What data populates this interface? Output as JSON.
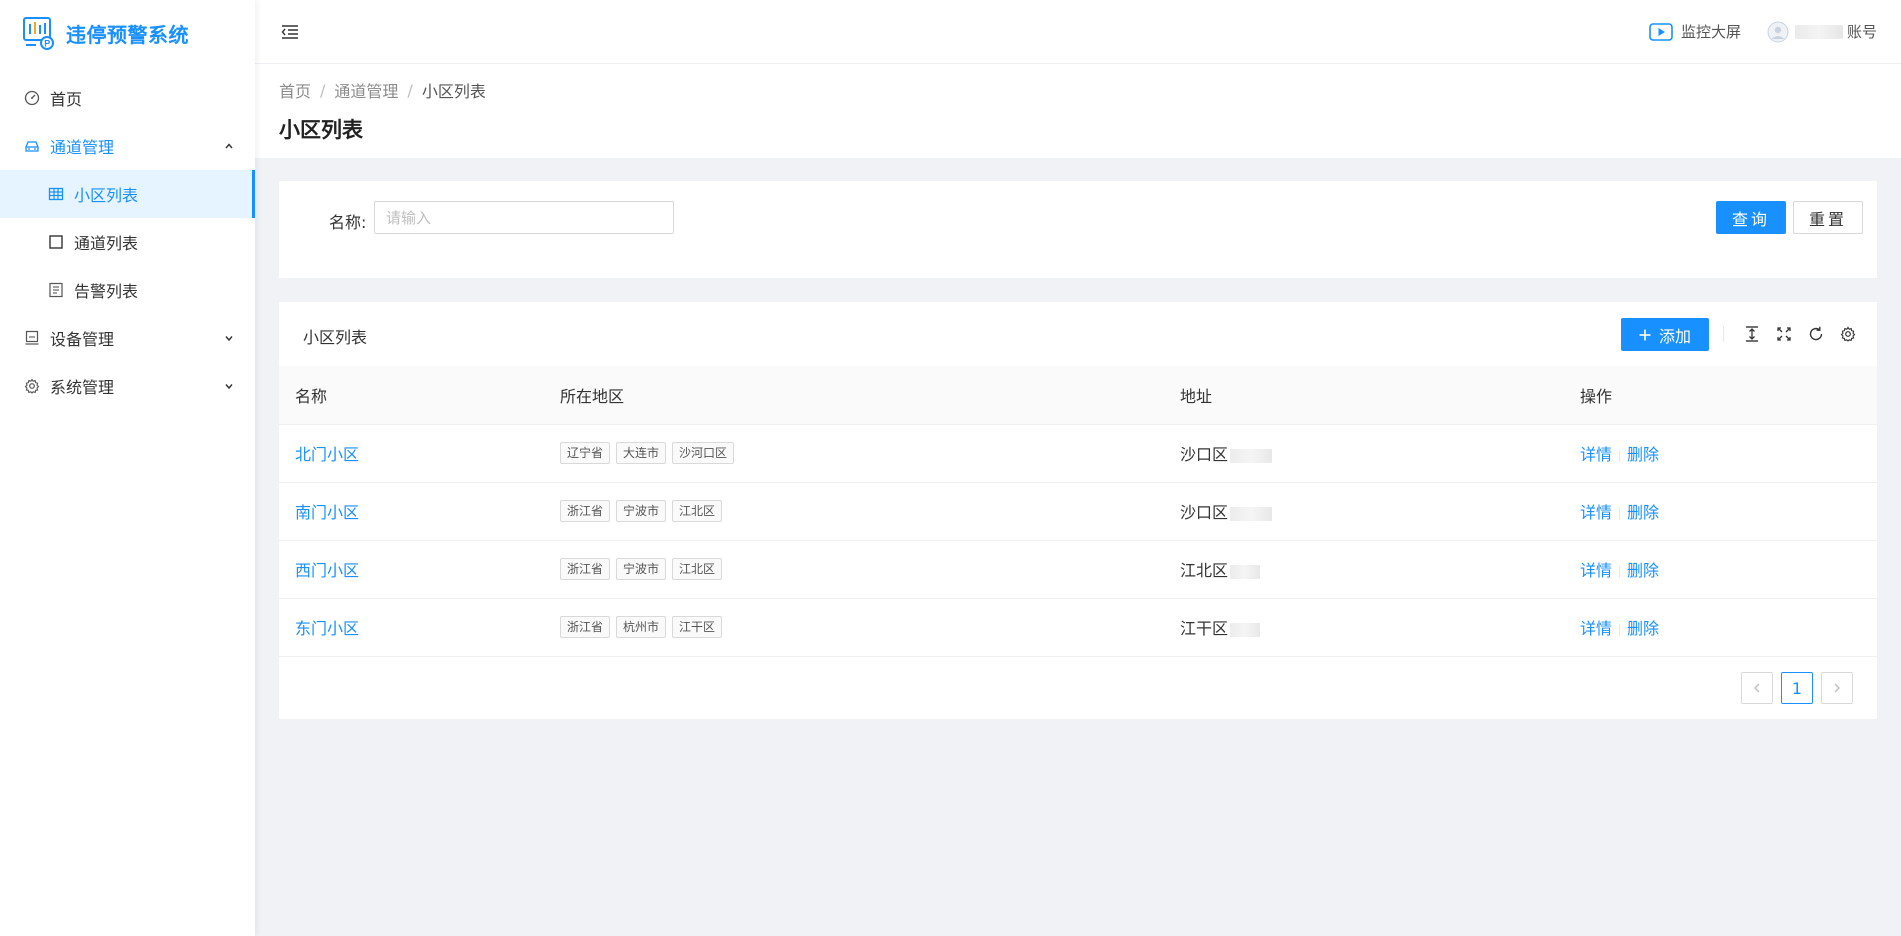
{
  "app": {
    "title": "违停预警系统"
  },
  "colors": {
    "primary": "#1890ff",
    "active_bg": "#e6f4ff"
  },
  "sidebar": {
    "items": [
      {
        "label": "首页",
        "icon": "dashboard-icon"
      },
      {
        "label": "通道管理",
        "icon": "car-icon",
        "open": true,
        "children": [
          {
            "label": "小区列表",
            "icon": "table-icon",
            "active": true
          },
          {
            "label": "通道列表",
            "icon": "square-icon"
          },
          {
            "label": "告警列表",
            "icon": "list-icon"
          }
        ]
      },
      {
        "label": "设备管理",
        "icon": "device-icon"
      },
      {
        "label": "系统管理",
        "icon": "gear-icon"
      }
    ]
  },
  "header": {
    "monitor_label": "监控大屏",
    "account_label": "账号"
  },
  "breadcrumb": [
    "首页",
    "通道管理",
    "小区列表"
  ],
  "page_title": "小区列表",
  "search": {
    "name_label": "名称:",
    "name_placeholder": "请输入",
    "query_label": "查询",
    "reset_label": "重置"
  },
  "table": {
    "title": "小区列表",
    "add_label": "添加",
    "columns": [
      "名称",
      "所在地区",
      "地址",
      "操作"
    ],
    "rows": [
      {
        "name": "北门小区",
        "tags": [
          "辽宁省",
          "大连市",
          "沙河口区"
        ],
        "address": "沙口区"
      },
      {
        "name": "南门小区",
        "tags": [
          "浙江省",
          "宁波市",
          "江北区"
        ],
        "address": "沙口区"
      },
      {
        "name": "西门小区",
        "tags": [
          "浙江省",
          "宁波市",
          "江北区"
        ],
        "address": "江北区"
      },
      {
        "name": "东门小区",
        "tags": [
          "浙江省",
          "杭州市",
          "江干区"
        ],
        "address": "江干区"
      }
    ],
    "op_detail": "详情",
    "op_delete": "删除"
  },
  "pagination": {
    "current": "1"
  }
}
